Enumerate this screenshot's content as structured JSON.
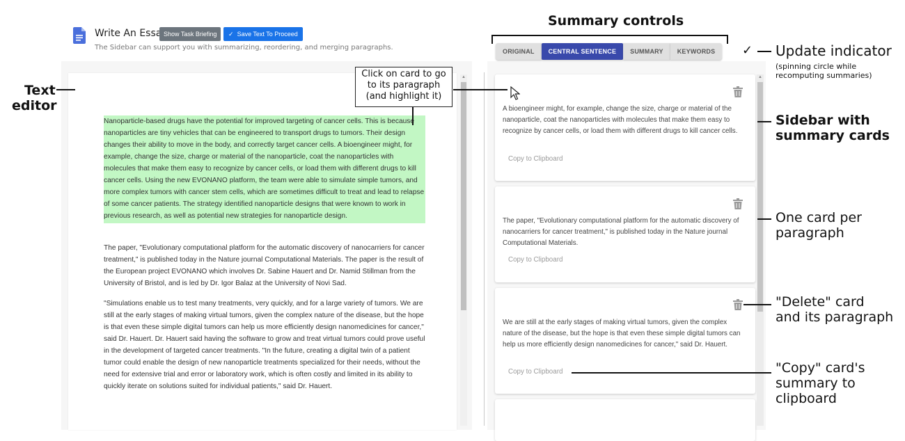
{
  "header": {
    "title": "Write An Essay",
    "briefing_button": "Show Task Briefing",
    "save_button": "Save Text To Proceed",
    "save_icon": "check-icon",
    "subtitle": "The Sidebar can support you with summarizing, reordering, and merging paragraphs."
  },
  "editor": {
    "paragraphs": [
      {
        "text": "Nanoparticle-based drugs have the potential for improved targeting of cancer cells. This is because nanoparticles are tiny vehicles that can be engineered to transport drugs to tumors. Their design changes their ability to move in the body, and correctly target cancer cells. A bioengineer might, for example, change the size, charge or material of the nanoparticle, coat the nanoparticles with molecules that make them easy to recognize by cancer cells, or load them with different drugs to kill cancer cells. Using the new EVONANO platform, the team were able to simulate simple tumors, and more complex tumors with cancer stem cells, which are sometimes difficult to treat and lead to relapse of some cancer patients. The strategy identified nanoparticle designs that were known to work in previous research, as well as potential new strategies for nanoparticle design.",
        "highlighted": true,
        "highlight_color": "#c2f7c4"
      },
      {
        "text": "The paper, \"Evolutionary computational platform for the automatic discovery of nanocarriers for cancer treatment,\" is published today in the Nature journal Computational Materials. The paper is the result of the European project EVONANO which involves Dr. Sabine Hauert and Dr. Namid Stillman from the University of Bristol, and is led by Dr. Igor Balaz at the University of Novi Sad.",
        "highlighted": false
      },
      {
        "text": "\"Simulations enable us to test many treatments, very quickly, and for a large variety of tumors. We are still at the early stages of making virtual tumors, given the complex nature of the disease, but the hope is that even these simple digital tumors can help us more efficiently design nanomedicines for cancer,\" said Dr. Hauert. Dr. Hauert said having the software to grow and treat virtual tumors could prove useful in the development of targeted cancer treatments. \"In the future, creating a digital twin of a patient tumor could enable the design of new nanoparticle treatments specialized for their needs, without the need for extensive trial and error or laboratory work, which is often costly and limited in its ability to quickly iterate on solutions suited for individual patients,\" said Dr. Hauert.",
        "highlighted": false
      }
    ]
  },
  "sidebar": {
    "tabs": [
      {
        "label": "ORIGINAL",
        "active": false
      },
      {
        "label": "CENTRAL SENTENCE",
        "active": true
      },
      {
        "label": "SUMMARY",
        "active": false
      },
      {
        "label": "KEYWORDS",
        "active": false
      }
    ],
    "accent_color": "#3949ab",
    "update_indicator": "✓",
    "cards": [
      {
        "text": "A bioengineer might, for example, change the size, charge or material of the nanoparticle, coat the nanoparticles with molecules that make them easy to recognize by cancer cells, or load them with different drugs to kill cancer cells.",
        "copy_label": "Copy to Clipboard",
        "delete_icon": "trash-icon"
      },
      {
        "text": "The paper, \"Evolutionary computational platform for the automatic discovery of nanocarriers for cancer treatment,\" is published today in the Nature journal Computational Materials.",
        "copy_label": "Copy to Clipboard",
        "delete_icon": "trash-icon"
      },
      {
        "text": "We are still at the early stages of making virtual tumors, given the complex nature of the disease, but the hope is that even these simple digital tumors can help us more efficiently design nanomedicines for cancer,\" said Dr. Hauert.",
        "copy_label": "Copy to Clipboard",
        "delete_icon": "trash-icon"
      }
    ]
  },
  "annotations": {
    "summary_controls": "Summary controls",
    "update_indicator": "Update indicator",
    "update_indicator_note_1": "(spinning circle while",
    "update_indicator_note_2": "recomputing summaries)",
    "text_editor_1": "Text",
    "text_editor_2": "editor",
    "click_card_1": "Click on card to go",
    "click_card_2": "to its paragraph",
    "click_card_3": "(and highlight it)",
    "sidebar_1": "Sidebar with",
    "sidebar_2": "summary cards",
    "one_card_1": "One card per",
    "one_card_2": "paragraph",
    "delete_1": "\"Delete\" card",
    "delete_2": "and its paragraph",
    "copy_1": "\"Copy\" card's",
    "copy_2": "summary to",
    "copy_3": "clipboard"
  }
}
